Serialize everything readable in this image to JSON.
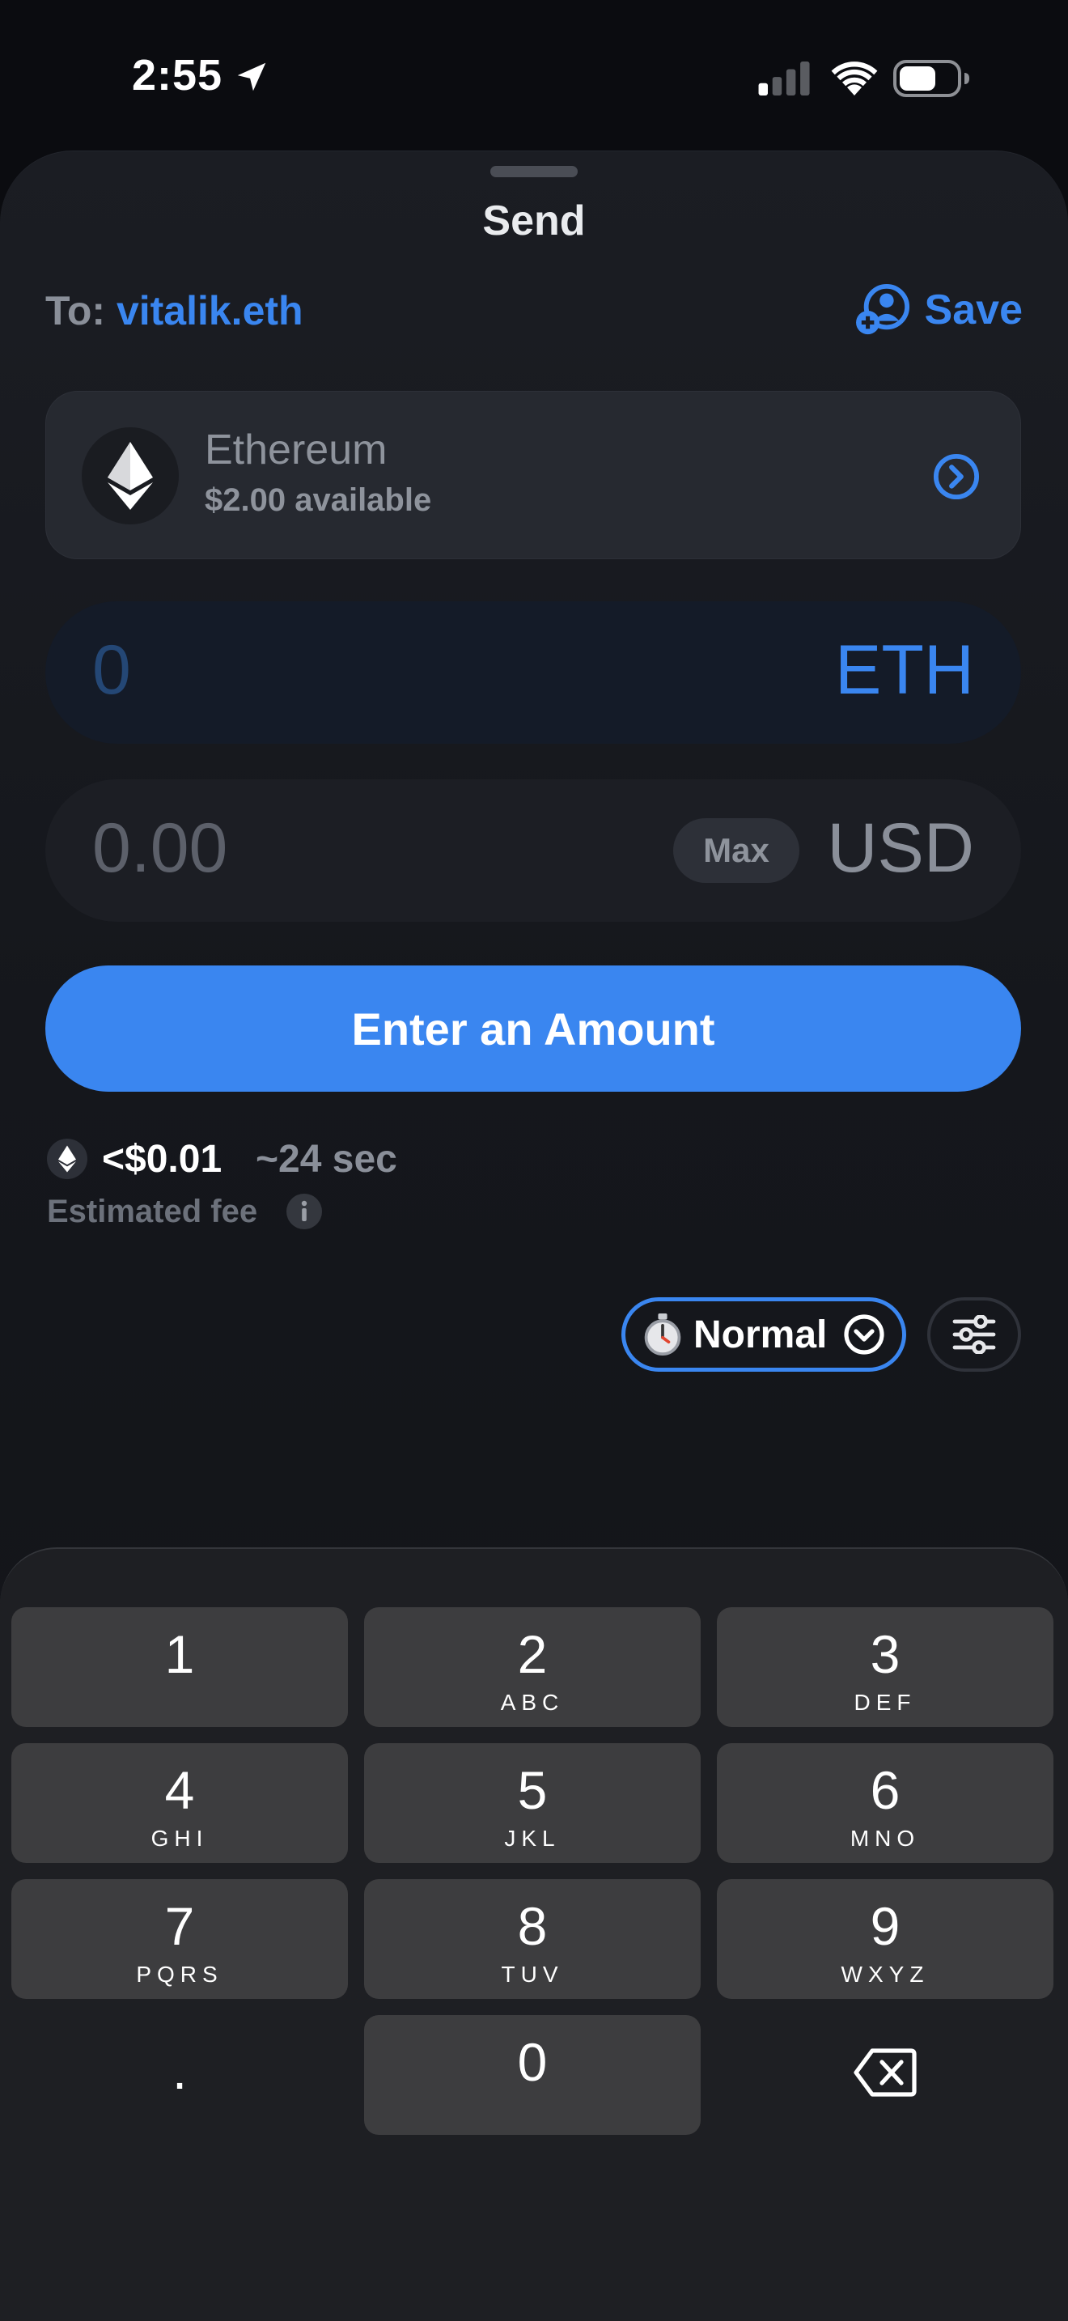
{
  "status_bar": {
    "time": "2:55",
    "icons": [
      "location-arrow-icon",
      "cellular-signal-icon",
      "wifi-icon",
      "battery-icon"
    ]
  },
  "sheet": {
    "title": "Send",
    "recipient": {
      "label": "To:",
      "name": "vitalik.eth"
    },
    "save_label": "Save",
    "asset": {
      "name": "Ethereum",
      "available": "$2.00 available",
      "icon": "ethereum-icon"
    },
    "eth_amount": {
      "value": "0",
      "unit": "ETH"
    },
    "usd_amount": {
      "value": "0.00",
      "unit": "USD",
      "max_label": "Max"
    },
    "primary_button": "Enter an Amount",
    "fee": {
      "amount": "<$0.01",
      "time": "~24 sec",
      "label": "Estimated fee"
    },
    "speed": {
      "label": "Normal",
      "icon": "stopwatch-icon"
    },
    "settings_icon": "sliders-icon"
  },
  "keyboard": {
    "keys": [
      {
        "digit": "1",
        "letters": ""
      },
      {
        "digit": "2",
        "letters": "ABC"
      },
      {
        "digit": "3",
        "letters": "DEF"
      },
      {
        "digit": "4",
        "letters": "GHI"
      },
      {
        "digit": "5",
        "letters": "JKL"
      },
      {
        "digit": "6",
        "letters": "MNO"
      },
      {
        "digit": "7",
        "letters": "PQRS"
      },
      {
        "digit": "8",
        "letters": "TUV"
      },
      {
        "digit": "9",
        "letters": "WXYZ"
      },
      {
        "digit": ".",
        "letters": ""
      },
      {
        "digit": "0",
        "letters": ""
      }
    ],
    "delete_icon": "backspace-icon"
  },
  "colors": {
    "accent": "#3a86f0",
    "background": "#0b0c10",
    "card": "#262930",
    "key": "#3d3d3f"
  }
}
